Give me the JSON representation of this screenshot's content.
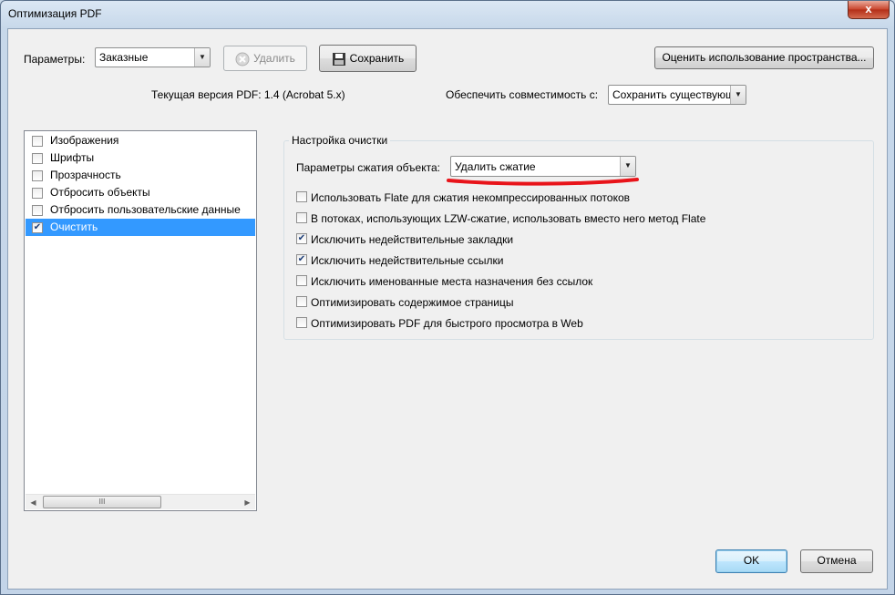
{
  "window": {
    "title": "Оптимизация PDF",
    "close_glyph": "x"
  },
  "toolbar": {
    "params_label": "Параметры:",
    "params_value": "Заказные",
    "delete_label": "Удалить",
    "save_label": "Сохранить",
    "evaluate_label": "Оценить использование пространства..."
  },
  "version": {
    "current_text": "Текущая версия PDF: 1.4 (Acrobat 5.x)",
    "compat_label": "Обеспечить совместимость с:",
    "compat_value": "Сохранить существующ"
  },
  "tree": {
    "items": [
      {
        "label": "Изображения",
        "checked": false
      },
      {
        "label": "Шрифты",
        "checked": false
      },
      {
        "label": "Прозрачность",
        "checked": false
      },
      {
        "label": "Отбросить объекты",
        "checked": false
      },
      {
        "label": "Отбросить пользовательские данные",
        "checked": false
      },
      {
        "label": "Очистить",
        "checked": true,
        "selected": true
      }
    ],
    "scroll_thumb_glyph": "III"
  },
  "cleanup": {
    "group_title": "Настройка очистки",
    "compression_label": "Параметры сжатия объекта:",
    "compression_value": "Удалить сжатие",
    "options": [
      {
        "label": "Использовать Flate для сжатия некомпрессированных потоков",
        "checked": false
      },
      {
        "label": "В потоках, использующих LZW-сжатие, использовать вместо него метод Flate",
        "checked": false
      },
      {
        "label": "Исключить недействительные закладки",
        "checked": true
      },
      {
        "label": "Исключить недействительные ссылки",
        "checked": true
      },
      {
        "label": "Исключить именованные места назначения без ссылок",
        "checked": false
      },
      {
        "label": "Оптимизировать содержимое страницы",
        "checked": false
      },
      {
        "label": "Оптимизировать PDF для быстрого просмотра в Web",
        "checked": false
      }
    ]
  },
  "footer": {
    "ok_label": "OK",
    "cancel_label": "Отмена"
  },
  "colors": {
    "selection": "#3399ff",
    "annotation": "#e8141a"
  }
}
